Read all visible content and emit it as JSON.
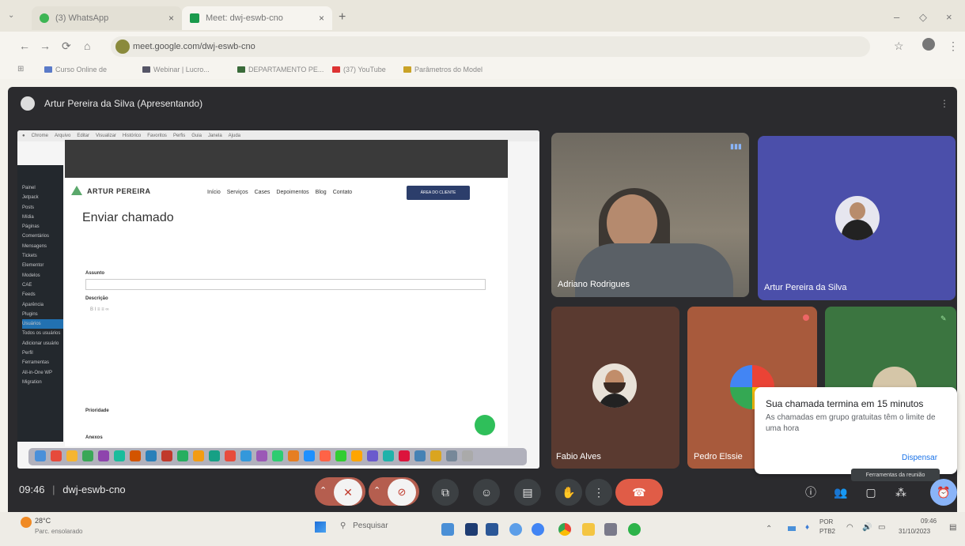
{
  "tabs": [
    {
      "label": "(3) WhatsApp",
      "close": "×"
    },
    {
      "label": "Meet: dwj-eswb-cno",
      "close": "×"
    }
  ],
  "new_tab": "+",
  "window_controls": {
    "minimize": "–",
    "restore": "◇",
    "close": "×"
  },
  "address": {
    "url": "meet.google.com/dwj-eswb-cno"
  },
  "bookmarks": [
    {
      "label": "Curso Online de",
      "color": "#5a7ac8"
    },
    {
      "label": "Webinar | Lucro...",
      "color": "#556"
    },
    {
      "label": "DEPARTAMENTO PE...",
      "color": "#3a6b3a"
    },
    {
      "label": "(37) YouTube",
      "color": "#d33"
    },
    {
      "label": "Parâmetros do Model",
      "color": "#c9a227"
    }
  ],
  "meet": {
    "presenter_label": "Artur Pereira da Silva (Apresentando)",
    "meeting_time": "09:46",
    "meeting_code": "dwj-eswb-cno",
    "tooltip": "Ferramentas da reunião"
  },
  "shared_screen": {
    "mac_menu": [
      "Chrome",
      "Arquivo",
      "Editar",
      "Visualizar",
      "Histórico",
      "Favoritos",
      "Perfis",
      "Guia",
      "Janela",
      "Ajuda"
    ],
    "site_logo": "ARTUR PEREIRA",
    "site_nav": [
      "Início",
      "Serviços",
      "Cases",
      "Depoimentos",
      "Blog",
      "Contato"
    ],
    "area_button": "ÁREA DO CLIENTE",
    "page_title": "Enviar chamado",
    "field_assunto": "Assunto",
    "field_descricao": "Descrição",
    "field_prioridade": "Prioridade",
    "field_anexos": "Anexos",
    "sidebar_items": [
      "Painel",
      "Jetpack",
      "Posts",
      "Mídia",
      "Páginas",
      "Comentários",
      "Mensagens",
      "Tickets",
      "Elementor",
      "Modelos",
      "CAE",
      "Feeds",
      "Aparência",
      "Plugins",
      "Usuários",
      "Todos os usuários",
      "Adicionar usuário",
      "Perfil",
      "Ferramentas",
      "All-in-One WP Migration"
    ]
  },
  "participants": [
    {
      "name": "Adriano Rodrigues"
    },
    {
      "name": "Artur Pereira da Silva"
    },
    {
      "name": "Fabio Alves"
    },
    {
      "name": "Pedro Elssie"
    }
  ],
  "notification": {
    "title": "Sua chamada termina em 15 minutos",
    "body": "As chamadas em grupo gratuitas têm o limite de uma hora",
    "action": "Dispensar"
  },
  "taskbar": {
    "weather_temp": "28°C",
    "weather_desc": "Parc. ensolarado",
    "search": "Pesquisar",
    "lang": "POR",
    "lang2": "PTB2",
    "time": "09:46",
    "date": "31/10/2023"
  },
  "colors": {
    "accent_end_call": "#e05c47",
    "meet_bg": "#2b2b2e",
    "artur_tile": "#4b4faa"
  }
}
